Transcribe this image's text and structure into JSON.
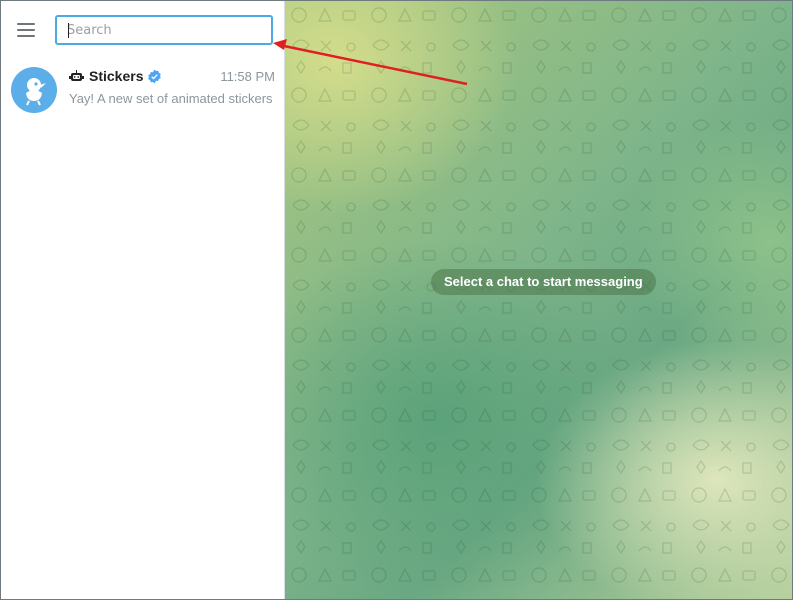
{
  "sidebar": {
    "search": {
      "placeholder": "Search",
      "value": ""
    },
    "chats": [
      {
        "name": "Stickers",
        "time": "11:58 PM",
        "preview": "Yay! A new set of animated stickers",
        "avatar_color": "#5caee8",
        "verified": true,
        "bot": true
      }
    ]
  },
  "main": {
    "empty_message": "Select a chat to start messaging"
  },
  "colors": {
    "accent": "#4da9e3",
    "verified": "#4ea4f6",
    "annotation_arrow": "#e02020"
  },
  "icons": {
    "menu": "hamburger-menu-icon",
    "bot": "bot-icon",
    "verified": "verified-badge-icon"
  }
}
